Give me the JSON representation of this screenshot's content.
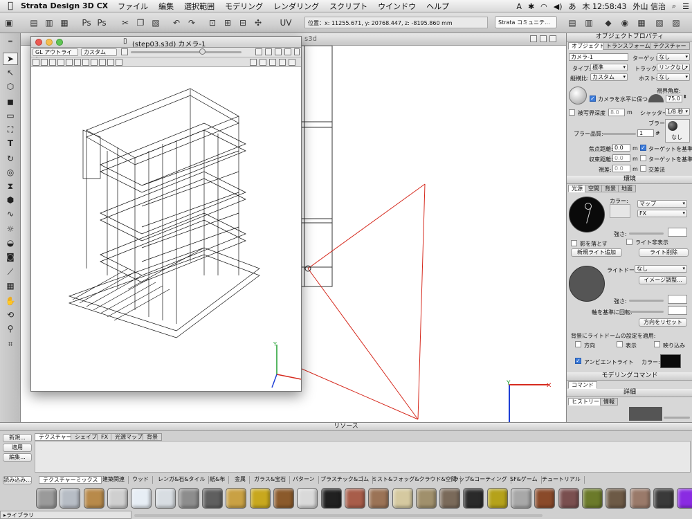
{
  "menubar": {
    "app_name": "Strata Design 3D CX",
    "items": [
      "ファイル",
      "編集",
      "選択範囲",
      "モデリング",
      "レンダリング",
      "スクリプト",
      "ウインドウ",
      "ヘルプ"
    ],
    "clock": "木 12:58:43",
    "user": "外山 信治",
    "ime": "あ"
  },
  "toolbar": {
    "coordinates": "位置：x: 11255.671, y: 20768.447, z: -8195.860 mm",
    "community": "Strata コミュニテ..."
  },
  "bg_window": {
    "title": "s3d"
  },
  "camera_window": {
    "title": "(step03.s3d) カメラ-1",
    "render_mode": "GL アウトライン",
    "view_mode": "カスタム"
  },
  "object_props": {
    "title": "オブジェクトプロパティ",
    "tabs": [
      "オブジェクト",
      "トランスフォーム",
      "テクスチャー"
    ],
    "name_value": "カメラ-1",
    "target_label": "ターゲット:",
    "target_value": "なし",
    "type_label": "タイプ:",
    "type_value": "標準",
    "track_label": "トラック:",
    "track_value": "リンクなし",
    "aspect_label": "縦横比:",
    "aspect_value": "カスタム",
    "host_label": "ホスト:",
    "host_value": "なし",
    "fov_label": "視界角度:",
    "fov_value": "75.0",
    "level_label": "カメラを水平に保つ",
    "dof_label": "被写界深度",
    "dof_value": "8.0",
    "dof_unit": "m",
    "shutter_label": "シャッター:",
    "shutter_value": "1/8 秒",
    "blur_label": "ブラー:",
    "blur_none": "なし",
    "blur_quality_label": "ブラー品質:",
    "blur_quality_value": "1",
    "blur_hash": "#",
    "focus_label": "焦点距離:",
    "focus_value": "0.0",
    "focus_unit": "m",
    "focus_check": "ターゲットを基準に",
    "conv_label": "収束距離:",
    "conv_value": "0.0",
    "conv_unit": "m",
    "conv_check": "ターゲットを基準に",
    "parallax_label": "視差:",
    "parallax_value": "0.0",
    "parallax_unit": "m",
    "cross_label": "交差法"
  },
  "environment": {
    "title": "環境",
    "tabs": [
      "光源",
      "空間",
      "背景",
      "地面"
    ],
    "color_label": "カラー:",
    "map_value": "マップ",
    "fx_value": "FX",
    "strength_label": "強さ:",
    "shadow_label": "影を落とす",
    "hide_light_label": "ライト非表示",
    "add_light_btn": "新規ライト追加",
    "delete_light_btn": "ライト削除",
    "dome_label": "ライトドーム:",
    "dome_value": "なし",
    "image_adjust_btn": "イメージ調整...",
    "strength2_label": "強さ:",
    "axis_label": "軸を基準に回転:",
    "reset_dir_btn": "方向をリセット",
    "apply_bg_label": "背景にライトドームの設定を適用:",
    "dir_label": "方向",
    "show_label": "表示",
    "reflect_label": "映り込み",
    "ambient_label": "アンビエントライト",
    "ambient_color_label": "カラー:"
  },
  "modeling_cmd": {
    "title": "モデリングコマンド",
    "tab": "コマンド"
  },
  "detail": {
    "title": "詳細",
    "tabs": [
      "ヒストリー",
      "情報"
    ]
  },
  "resources": {
    "title": "リソース",
    "tabs": [
      "テクスチャー",
      "シェイプ",
      "FX",
      "光源マップ",
      "背景"
    ],
    "buttons": {
      "new": "新規...",
      "apply": "適用",
      "edit": "編集...",
      "load": "読み込み...",
      "library": "▸ライブラリ"
    },
    "library_tabs": [
      "テクスチャーミックス",
      "建築関連",
      "ウッド",
      "レンガ&石&タイル",
      "紙&布",
      "金属",
      "ガラス&宝石",
      "パターン",
      "プラスチック&ゴム",
      "ミスト&フォッグ&クラウド&空間",
      "ラップ&コーティング",
      "SF&ゲーム",
      "チュートリアル"
    ],
    "swatch_colors": [
      "#9a9a9a",
      "#b7bdc5",
      "#b88a4a",
      "#cfcfcf",
      "#e7eef5",
      "#d8dde2",
      "#8d8d8d",
      "#5f5f5f",
      "#c9a144",
      "#c8a81e",
      "#8b5a2b",
      "#d9d9d9",
      "#202020",
      "#a85d4a",
      "#9b7356",
      "#d5c9a0",
      "#a0906c",
      "#7a6a5a",
      "#2a2a2a",
      "#b5a21a",
      "#a8a8a8",
      "#8a4a2a",
      "#7a4f4f",
      "#6b7a2a",
      "#6d5a46",
      "#9a7a6a",
      "#3a3a3a",
      "#8a2be2"
    ]
  }
}
